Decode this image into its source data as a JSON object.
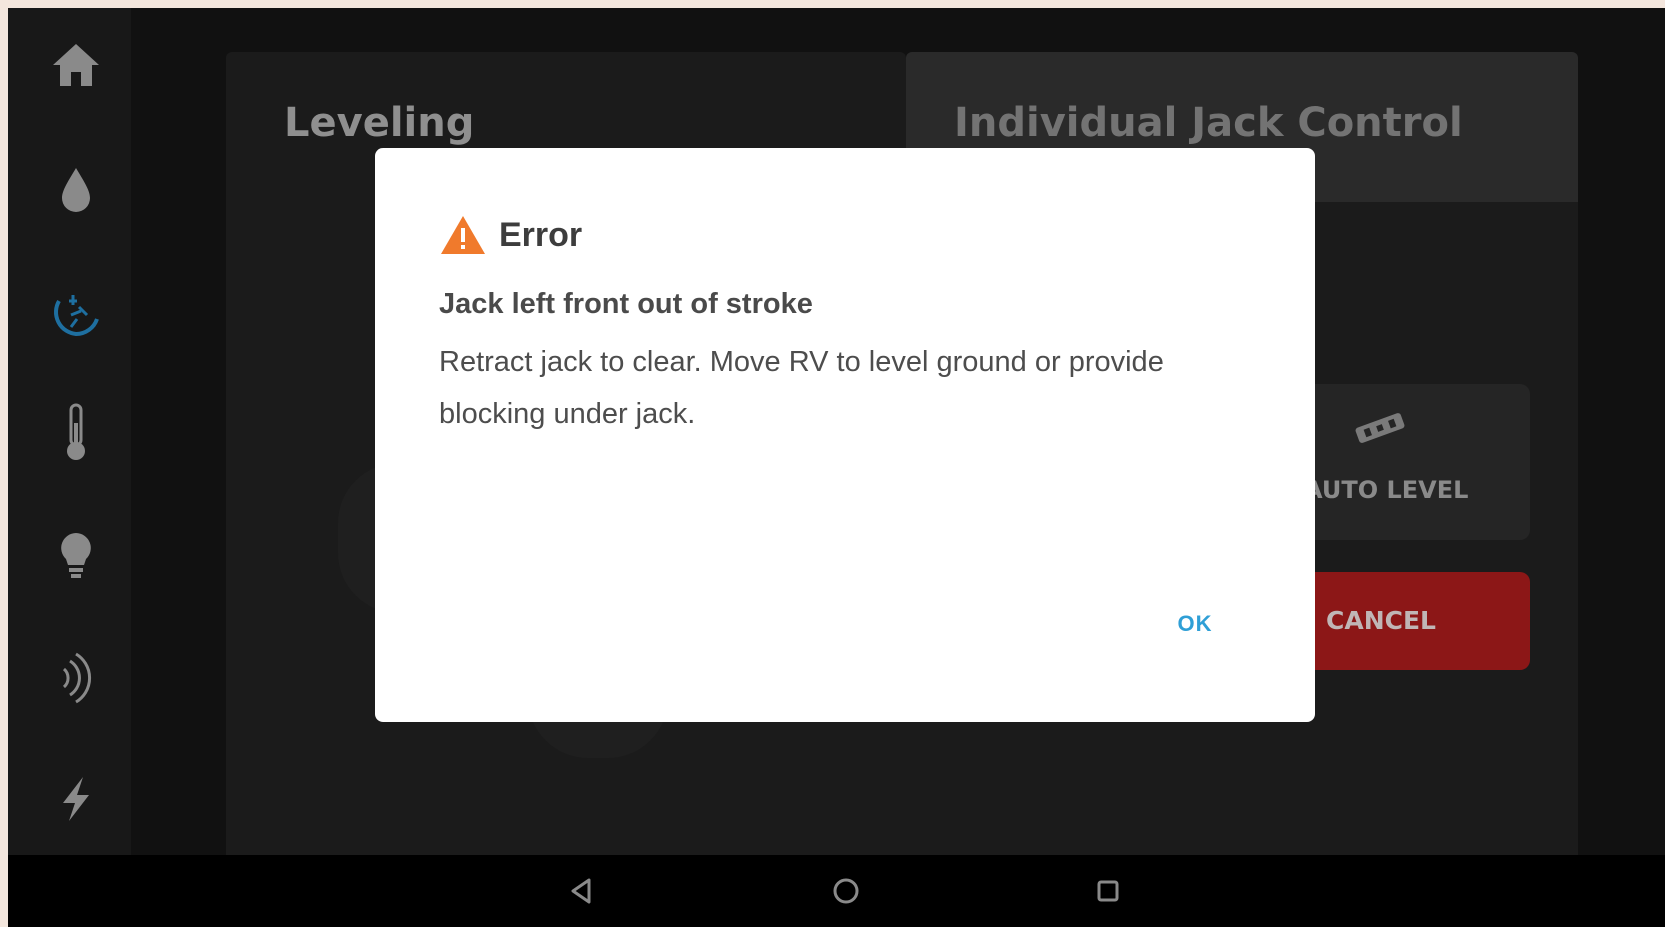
{
  "sidebar": {
    "items": [
      {
        "icon": "home-icon"
      },
      {
        "icon": "water-drop-icon"
      },
      {
        "icon": "leveling-icon",
        "active": true
      },
      {
        "icon": "thermometer-icon"
      },
      {
        "icon": "lightbulb-icon"
      },
      {
        "icon": "wireless-icon"
      },
      {
        "icon": "lightning-icon"
      }
    ],
    "active_color": "#1e6fa0",
    "icon_color": "#8a8a8a"
  },
  "leveling": {
    "title": "Leveling"
  },
  "individual_jack_control": {
    "title": "Individual Jack Control",
    "auto_level_label": "AUTO LEVEL",
    "cancel_label": "CANCEL"
  },
  "dialog": {
    "title": "Error",
    "heading": "Jack left front out of stroke",
    "message": "Retract jack to clear. Move RV to level ground or provide blocking under jack.",
    "ok_label": "OK",
    "warning_color": "#f07a2c",
    "ok_color": "#2f9fd6"
  },
  "navbar": {
    "buttons": [
      {
        "icon": "back-icon"
      },
      {
        "icon": "home-circle-icon"
      },
      {
        "icon": "recents-icon"
      }
    ]
  }
}
